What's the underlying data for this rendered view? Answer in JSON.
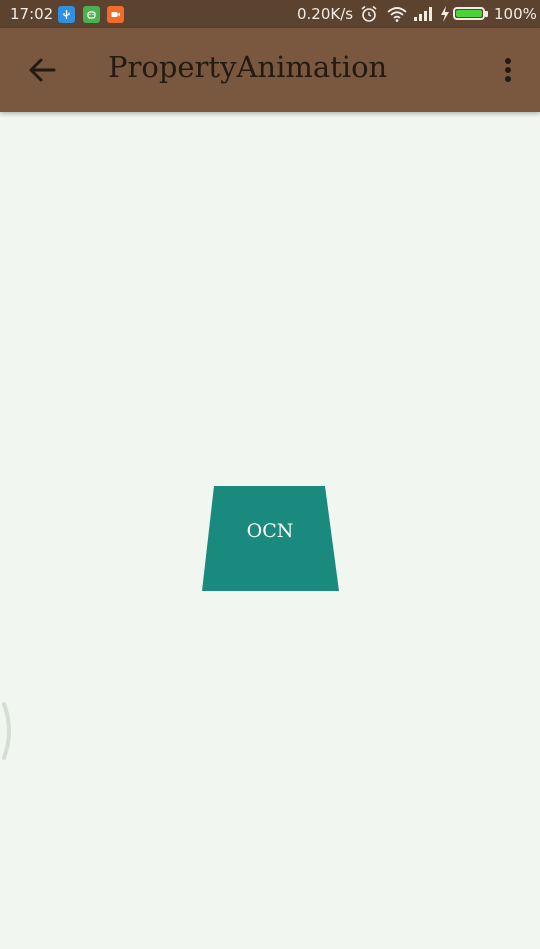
{
  "status_bar": {
    "time": "17:02",
    "network_speed": "0.20K/s",
    "battery_percent": "100%",
    "battery_level": 1.0,
    "notification_icons": [
      "usb-icon",
      "android-icon",
      "video-icon"
    ],
    "colors": {
      "usb": "#2f8fe0",
      "android": "#4caf50",
      "video": "#f26b2a"
    }
  },
  "app_bar": {
    "title": "PropertyAnimation",
    "background": "#7a5840",
    "navigation_icon": "arrow-left-icon",
    "menu_icon": "more-vert-icon"
  },
  "content": {
    "animated_view_label": "OCN",
    "animated_view_color": "#1b8a7e",
    "background": "#f2f6f1"
  }
}
